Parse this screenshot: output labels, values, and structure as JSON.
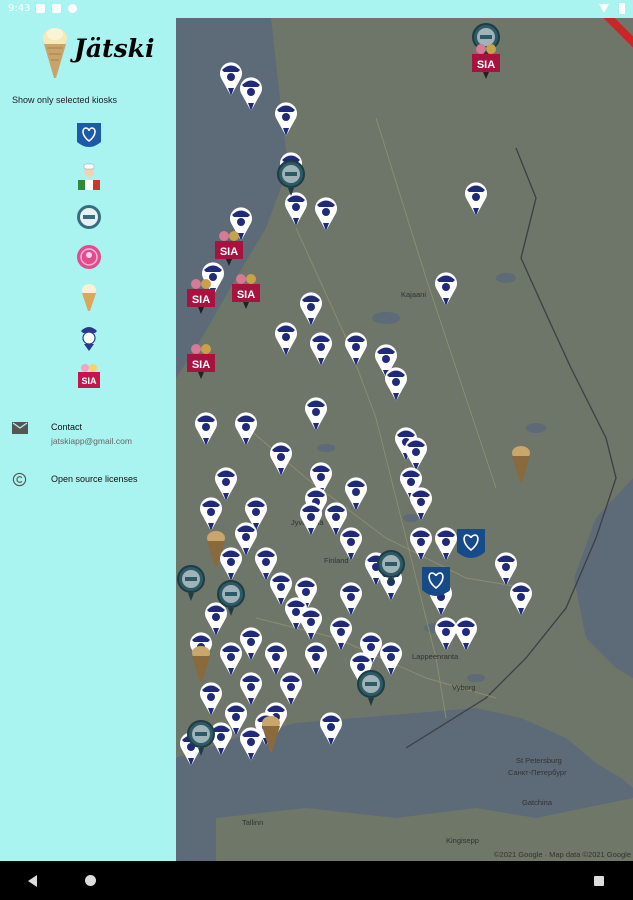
{
  "status_bar": {
    "time": "9:43"
  },
  "drawer": {
    "app_title": "Jätski",
    "filter_label": "Show only selected kiosks",
    "kiosks": [
      {
        "icon": "ice-cream-brand-heart-icon",
        "color": "#1d5aa8"
      },
      {
        "icon": "pastry-chef-kiosk-icon",
        "color": "#c23b2e"
      },
      {
        "icon": "round-seal-kiosk-icon",
        "color": "#356e80"
      },
      {
        "icon": "pink-badge-kiosk-icon",
        "color": "#e44b8e"
      },
      {
        "icon": "ice-cream-cone-icon",
        "color": "#e8c27a"
      },
      {
        "icon": "penguin-mascot-icon",
        "color": "#283a8a"
      },
      {
        "icon": "sia-brand-icon",
        "color": "#c4164d"
      }
    ],
    "contact": {
      "title": "Contact",
      "email": "jatskiapp@gmail.com"
    },
    "licenses": {
      "title": "Open source licenses"
    }
  },
  "map": {
    "places": [
      "Kajaani",
      "Jyväskylä",
      "Finland",
      "Lappeenranta",
      "Vyborg",
      "St Petersburg",
      "Санкт-Петербург",
      "Gatchina",
      "Tallinn",
      "Kingisepp"
    ],
    "attribution": "©2021 Google · Map data ©2021 Google"
  },
  "colors": {
    "drawer_bg": "#a9f3f0",
    "map_dim": "#6e7569",
    "water": "#5d6a78",
    "pin_fill": "#ffffff",
    "pin_brand": "#1f2a7a"
  }
}
